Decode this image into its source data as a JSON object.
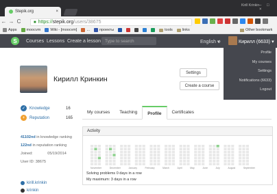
{
  "browser": {
    "tab_title": "Stepik.org",
    "tab_close": "×",
    "window_user": "Kirill Krinkin",
    "window_controls": "– □ ×",
    "back": "←",
    "forward": "→",
    "reload": "C",
    "url_scheme": "https://",
    "url_host": "stepik.org",
    "url_path": "/users/38675",
    "bookmarks": [
      "Apps",
      "moocvm",
      "Wiki - [moocvm]",
      "...",
      "проекты",
      "",
      "",
      "",
      "",
      "",
      "",
      "",
      "tools",
      "links"
    ],
    "other_bookmarks": "Other bookmark"
  },
  "nav": {
    "logo": "S",
    "courses": "Courses",
    "lessons": "Lessons",
    "create": "Create a lesson",
    "search_placeholder": "Type to search",
    "language": "English",
    "user": "Кирилл (6633)"
  },
  "dropdown": [
    "Profile",
    "My courses",
    "Settings",
    "Notifications (6633)",
    "Logout"
  ],
  "profile": {
    "name": "Кирилл Кринкин",
    "settings": "Settings",
    "create_course": "Create a course",
    "knowledge_label": "Knowledge",
    "knowledge": "16",
    "reputation_label": "Reputation",
    "reputation": "165",
    "knowledge_rank": "41102nd",
    "knowledge_rank_text": "in knowledge ranking",
    "reputation_rank": "122nd",
    "reputation_rank_text": "in reputation ranking",
    "joined_label": "Joined:",
    "joined": "05/19/2014",
    "user_id_label": "User ID:",
    "user_id": "38675",
    "social1": "kirill.krinkin",
    "social2": "krinkin"
  },
  "tabs": [
    "My courses",
    "Teaching",
    "Profile",
    "Certificates"
  ],
  "activity": {
    "title": "Activity",
    "months": [
      "November",
      "December",
      "January",
      "February",
      "March",
      "April",
      "May",
      "June",
      "July",
      "August",
      "September"
    ],
    "solving": "Solving problems 0 days in a row",
    "maximum": "My maximum: 3 days in a row"
  },
  "colors": {
    "accent": "#66cc66",
    "navbar": "#45474e",
    "link": "#2e6fa7"
  }
}
